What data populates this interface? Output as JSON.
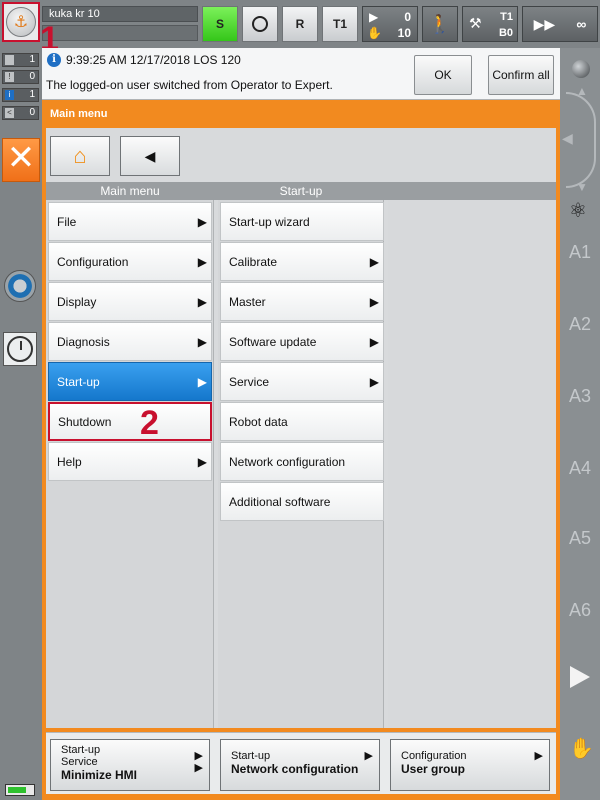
{
  "topbar": {
    "robot_name": "kuka kr 10",
    "s_label": "S",
    "r_label": "R",
    "t1_label": "T1",
    "prog_value_1": "0",
    "prog_value_2": "10",
    "tool_label": "T1",
    "base_label": "B0",
    "override_label": "∞"
  },
  "callouts": {
    "one": "1",
    "two": "2"
  },
  "left_counters": [
    {
      "value": "1"
    },
    {
      "value": "0"
    },
    {
      "value": "1"
    },
    {
      "value": "0"
    }
  ],
  "message": {
    "time": "9:39:25 AM 12/17/2018 LOS 120",
    "text": "The logged-on user switched from Operator to Expert.",
    "ok_label": "OK",
    "confirm_all_label": "Confirm all"
  },
  "panel": {
    "title": "Main menu",
    "main_header": "Main menu",
    "sub_header": "Start-up",
    "main_items": [
      {
        "label": "File",
        "arrow": "▶"
      },
      {
        "label": "Configuration",
        "arrow": "▶"
      },
      {
        "label": "Display",
        "arrow": "▶"
      },
      {
        "label": "Diagnosis",
        "arrow": "▶"
      },
      {
        "label": "Start-up",
        "arrow": "▶"
      },
      {
        "label": "Shutdown",
        "arrow": ""
      },
      {
        "label": "Help",
        "arrow": "▶"
      }
    ],
    "sub_items": [
      {
        "label": "Start-up wizard",
        "arrow": ""
      },
      {
        "label": "Calibrate",
        "arrow": "▶"
      },
      {
        "label": "Master",
        "arrow": "▶"
      },
      {
        "label": "Software update",
        "arrow": "▶"
      },
      {
        "label": "Service",
        "arrow": "▶"
      },
      {
        "label": "Robot data",
        "arrow": ""
      },
      {
        "label": "Network configuration",
        "arrow": ""
      },
      {
        "label": "Additional software",
        "arrow": ""
      }
    ]
  },
  "softkeys": [
    {
      "line1": "Start-up",
      "line2": "Service",
      "line3": "Minimize HMI"
    },
    {
      "line1": "Start-up",
      "line2": "Network configuration"
    },
    {
      "line1": "Configuration",
      "line2": "User group"
    }
  ],
  "right_axes": [
    "A1",
    "A2",
    "A3",
    "A4",
    "A5",
    "A6"
  ],
  "colors": {
    "accent_orange": "#f28a1f",
    "active_blue": "#1577cc",
    "callout_red": "#c8102e",
    "status_green": "#34c619"
  },
  "icons": {
    "logo": "kuka-robot-logo-icon",
    "home": "home-icon",
    "back": "back-arrow-icon",
    "close": "close-icon",
    "info": "info-icon",
    "gear": "gear-icon",
    "clock": "clock-icon",
    "globe": "globe-icon",
    "walk": "walking-person-icon",
    "hand": "hand-icon",
    "play": "play-icon"
  }
}
